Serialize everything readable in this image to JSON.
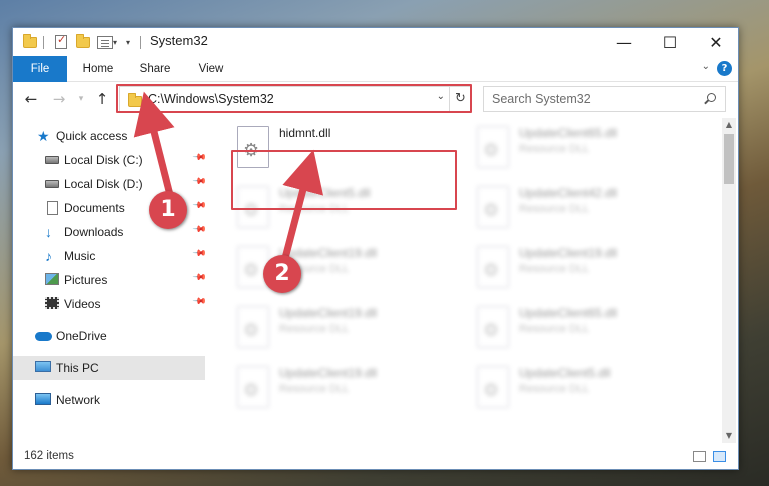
{
  "window": {
    "title": "System32",
    "controls": {
      "minimize": "—",
      "maximize": "☐",
      "close": "✕"
    }
  },
  "ribbon": {
    "tabs": [
      "File",
      "Home",
      "Share",
      "View"
    ],
    "help": "?"
  },
  "nav": {
    "back": "←",
    "forward": "→",
    "up": "↑",
    "address": "C:\\Windows\\System32",
    "refresh": "↻",
    "search_placeholder": "Search System32"
  },
  "sidebar": {
    "quick_access": "Quick access",
    "items": [
      {
        "label": "Local Disk (C:)",
        "icon": "drive-icon"
      },
      {
        "label": "Local Disk (D:)",
        "icon": "drive-icon"
      },
      {
        "label": "Documents",
        "icon": "documents-icon"
      },
      {
        "label": "Downloads",
        "icon": "downloads-icon"
      },
      {
        "label": "Music",
        "icon": "music-icon"
      },
      {
        "label": "Pictures",
        "icon": "pictures-icon"
      },
      {
        "label": "Videos",
        "icon": "videos-icon"
      }
    ],
    "onedrive": "OneDrive",
    "this_pc": "This PC",
    "network": "Network"
  },
  "files": [
    {
      "name": "hidmnt.dll",
      "type": ""
    },
    {
      "name": "UpdateClient65.dll",
      "type": "Resource DLL"
    },
    {
      "name": "UpdateClient5.dll",
      "type": "Resource DLL"
    },
    {
      "name": "UpdateClient42.dll",
      "type": "Resource DLL"
    },
    {
      "name": "UpdateClient19.dll",
      "type": "Resource DLL"
    },
    {
      "name": "UpdateClient19.dll",
      "type": "Resource DLL"
    },
    {
      "name": "UpdateClient19.dll",
      "type": "Resource DLL"
    },
    {
      "name": "UpdateClient65.dll",
      "type": "Resource DLL"
    },
    {
      "name": "UpdateClient19.dll",
      "type": "Resource DLL"
    },
    {
      "name": "UpdateClient5.dll",
      "type": "Resource DLL"
    }
  ],
  "status": {
    "count": "162 items"
  },
  "annotations": {
    "step1": "1",
    "step2": "2",
    "color": "#d8464f"
  }
}
